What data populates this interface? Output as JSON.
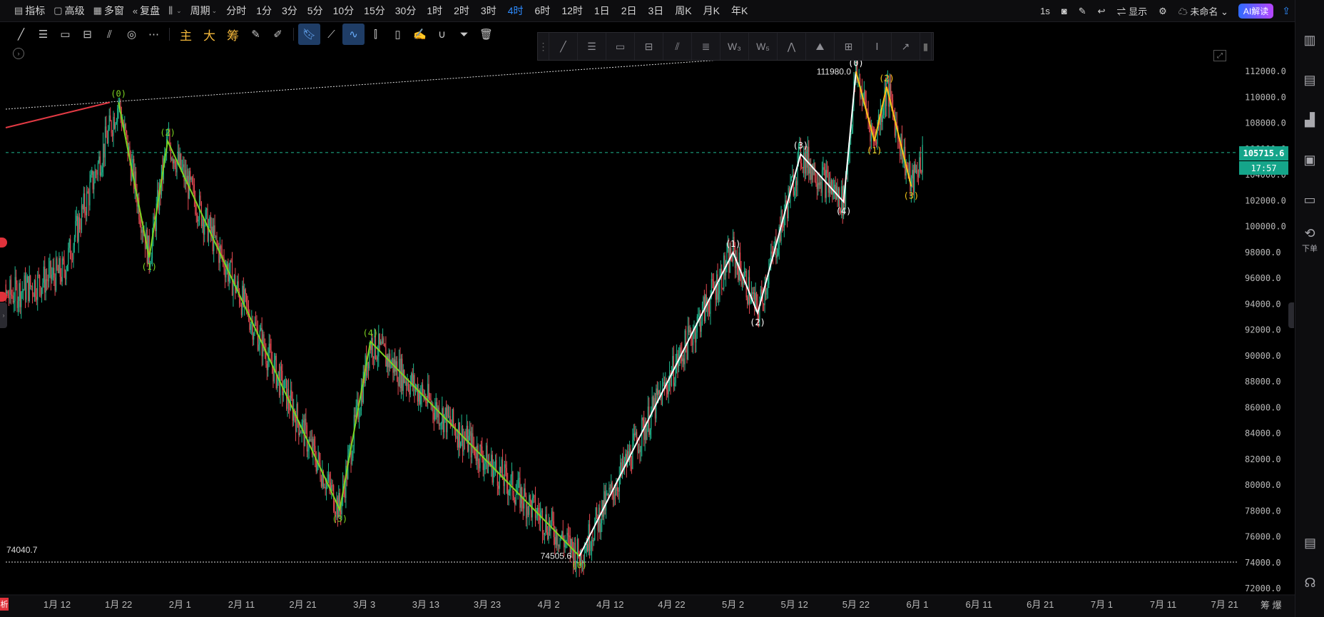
{
  "topbar": {
    "items": [
      {
        "glyph": "▤",
        "label": "指标",
        "icon": "indicator-icon"
      },
      {
        "glyph": "▢",
        "label": "高级",
        "icon": "advanced-icon"
      },
      {
        "glyph": "▦",
        "label": "多窗",
        "icon": "multi-window-icon"
      },
      {
        "glyph": "«",
        "label": "复盘",
        "icon": "replay-icon"
      },
      {
        "glyph": "⫼",
        "label": "",
        "icon": "chart-type-icon",
        "caret": true
      },
      {
        "glyph": "",
        "label": "周期",
        "icon": "",
        "caret": true
      }
    ],
    "periods": [
      "分时",
      "1分",
      "3分",
      "5分",
      "10分",
      "15分",
      "30分",
      "1时",
      "2时",
      "3时",
      "4时",
      "6时",
      "12时",
      "1日",
      "2日",
      "3日",
      "周K",
      "月K",
      "年K"
    ],
    "active_period": "4时",
    "right": {
      "refresh": "1s",
      "display": "显示",
      "layout_name": "未命名",
      "ai": "AI解读"
    }
  },
  "toolbar2": {
    "cn_tools": [
      "主",
      "大",
      "筹"
    ]
  },
  "chart_data": {
    "type": "candlestick",
    "ylim": [
      71500,
      113000
    ],
    "y_ticks": [
      112000,
      110000,
      108000,
      106000,
      104000,
      102000,
      100000,
      98000,
      96000,
      94000,
      92000,
      90000,
      88000,
      86000,
      84000,
      82000,
      80000,
      78000,
      76000,
      74000,
      72000
    ],
    "y_tick_labels": [
      "112000.0",
      "110000.0",
      "108000.0",
      "106000.0",
      "104000.0",
      "102000.0",
      "100000.0",
      "98000.0",
      "96000.0",
      "94000.0",
      "92000.0",
      "90000.0",
      "88000.0",
      "86000.0",
      "84000.0",
      "82000.0",
      "80000.0",
      "78000.0",
      "76000.0",
      "74000.0",
      "72000.0"
    ],
    "x_ticks": [
      "1月 12",
      "1月 22",
      "2月 1",
      "2月 11",
      "2月 21",
      "3月 3",
      "3月 13",
      "3月 23",
      "4月 2",
      "4月 12",
      "4月 22",
      "5月 2",
      "5月 12",
      "5月 22",
      "6月 1",
      "6月 11",
      "6月 21",
      "7月 1",
      "7月 11",
      "7月 21"
    ],
    "last_price": "105715.6",
    "countdown": "17:57",
    "annotations": {
      "high": "111980.0",
      "low": "74505.6",
      "left_low": "74040.7"
    },
    "waves": [
      {
        "color": "#7ed321",
        "points": [
          {
            "x": "1月 22",
            "y": 109600,
            "label": "(0)"
          },
          {
            "x": "1月 27",
            "y": 97600,
            "label": "(1)"
          },
          {
            "x": "1月 30",
            "y": 106600,
            "label": "(2)"
          },
          {
            "x": "2月 27",
            "y": 78100,
            "label": "(3)"
          },
          {
            "x": "3月 4",
            "y": 91100,
            "label": "(4)"
          },
          {
            "x": "4月 7",
            "y": 74500,
            "label": "(0)"
          }
        ]
      },
      {
        "color": "#ffffff",
        "points": [
          {
            "x": "4月 7",
            "y": 74500,
            "label": "(0)"
          },
          {
            "x": "5月 2",
            "y": 98000,
            "label": "(1)"
          },
          {
            "x": "5月 6",
            "y": 93300,
            "label": "(2)"
          },
          {
            "x": "5月 13",
            "y": 105600,
            "label": "(3)"
          },
          {
            "x": "5月 20",
            "y": 101900,
            "label": "(4)"
          },
          {
            "x": "5月 22",
            "y": 111980,
            "label": "(0)"
          }
        ]
      },
      {
        "color": "#f5c518",
        "points": [
          {
            "x": "5月 22",
            "y": 111980,
            "label": "(0)"
          },
          {
            "x": "5月 25",
            "y": 106600,
            "label": "(1)"
          },
          {
            "x": "5月 27",
            "y": 110800,
            "label": "(2)"
          },
          {
            "x": "5月 31",
            "y": 103100,
            "label": "(3)"
          }
        ]
      }
    ]
  },
  "sidebar": {
    "items": [
      {
        "icon": "layout-icon"
      },
      {
        "icon": "document-icon"
      },
      {
        "icon": "bar-chart-icon"
      },
      {
        "icon": "monitor-icon"
      },
      {
        "icon": "cards-icon"
      },
      {
        "icon": "order-icon",
        "label": "下单"
      }
    ]
  },
  "footer": {
    "left_tag": "析",
    "right_text": "筹 爆"
  }
}
